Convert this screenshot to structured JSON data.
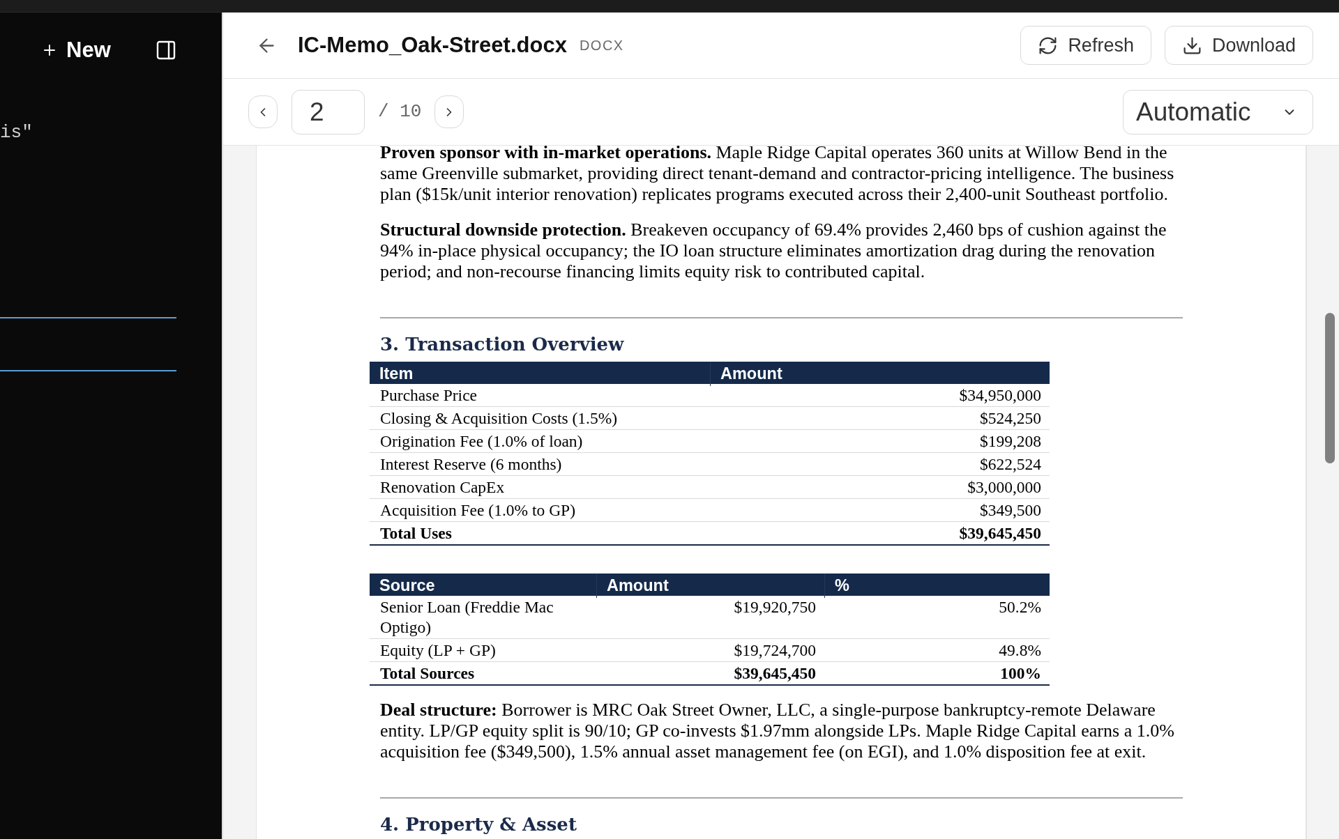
{
  "sidebar": {
    "new_label": "New",
    "snippet": "is\""
  },
  "header": {
    "title": "IC-Memo_Oak-Street.docx",
    "file_type": "DOCX",
    "actions": [
      {
        "kind": "refresh",
        "label": "Refresh"
      },
      {
        "kind": "download",
        "label": "Download"
      }
    ]
  },
  "pager": {
    "page": "2",
    "total": "/ 10",
    "zoom": "Automatic"
  },
  "document": {
    "blocks": [
      {
        "kind": "paragraph",
        "text": "**Proven sponsor with in-market operations.** Maple Ridge Capital operates 360 units at Willow Bend in the same Greenville submarket, providing direct tenant-demand and contractor-pricing intelligence. The business plan ($15k/unit interior renovation) replicates programs executed across their 2,400-unit Southeast portfolio."
      },
      {
        "kind": "paragraph",
        "text": "**Structural downside protection.** Breakeven occupancy of 69.4% provides 2,460 bps of cushion against the 94% in-place physical occupancy; the IO loan structure eliminates amortization drag during the renovation period; and non-recourse financing limits equity risk to contributed capital."
      },
      {
        "kind": "rule"
      },
      {
        "kind": "heading",
        "text": "3. Transaction Overview"
      },
      {
        "kind": "table",
        "columns": [
          "Item",
          "Amount"
        ],
        "rows": [
          {
            "kind": "item",
            "cells": [
              "Purchase Price",
              "$34,950,000"
            ]
          },
          {
            "kind": "item",
            "cells": [
              "Closing & Acquisition Costs (1.5%)",
              "$524,250"
            ]
          },
          {
            "kind": "item",
            "cells": [
              "Origination Fee (1.0% of loan)",
              "$199,208"
            ]
          },
          {
            "kind": "item",
            "cells": [
              "Interest Reserve (6 months)",
              "$622,524"
            ]
          },
          {
            "kind": "item",
            "cells": [
              "Renovation CapEx",
              "$3,000,000"
            ]
          },
          {
            "kind": "item",
            "cells": [
              "Acquisition Fee (1.0% to GP)",
              "$349,500"
            ]
          },
          {
            "kind": "total",
            "cells": [
              "Total Uses",
              "$39,645,450"
            ]
          }
        ]
      },
      {
        "kind": "table",
        "columns": [
          "Source",
          "Amount",
          "%"
        ],
        "rows": [
          {
            "kind": "item",
            "cells": [
              "Senior Loan (Freddie Mac Optigo)",
              "$19,920,750",
              "50.2%"
            ]
          },
          {
            "kind": "item",
            "cells": [
              "Equity (LP + GP)",
              "$19,724,700",
              "49.8%"
            ]
          },
          {
            "kind": "total",
            "cells": [
              "Total Sources",
              "$39,645,450",
              "100%"
            ]
          }
        ]
      },
      {
        "kind": "paragraph",
        "text": "**Deal structure:** Borrower is MRC Oak Street Owner, LLC, a single-purpose bankruptcy-remote Delaware entity. LP/GP equity split is 90/10; GP co-invests $1.97mm alongside LPs. Maple Ridge Capital earns a 1.0% acquisition fee ($349,500), 1.5% annual asset management fee (on EGI), and 1.0% disposition fee at exit."
      },
      {
        "kind": "rule"
      },
      {
        "kind": "heading",
        "text": "4. Property & Asset"
      }
    ]
  }
}
